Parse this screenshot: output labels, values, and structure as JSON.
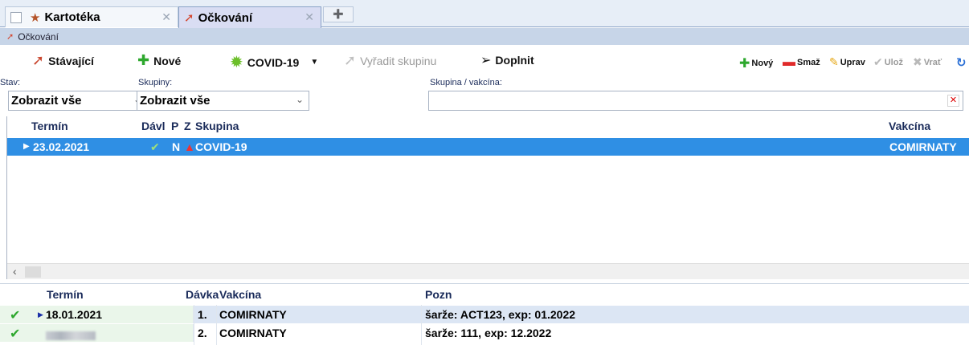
{
  "tabs": [
    {
      "label": "Kartotéka",
      "icon": "people-icon"
    },
    {
      "label": "Očkování",
      "icon": "syringe-icon",
      "active": true
    }
  ],
  "subtitle": "Očkování",
  "toolbar": {
    "existing": "Stávající",
    "new": "Nové",
    "covid": "COVID-19",
    "remove_group": "Vyřadit skupinu",
    "fill": "Doplnit",
    "small_new": "Nový",
    "small_delete": "Smaž",
    "small_edit": "Uprav",
    "small_save": "Ulož",
    "small_revert": "Vrať"
  },
  "filters": {
    "stav_label": "Stav:",
    "stav_value": "Zobrazit vše",
    "skupiny_label": "Skupiny:",
    "skupiny_value": "Zobrazit vše",
    "search_label": "Skupina / vakcína:",
    "search_value": ""
  },
  "upper_grid": {
    "columns": [
      "Termín",
      "Dávl",
      "P",
      "Z",
      "Skupina",
      "Vakcína"
    ],
    "rows": [
      {
        "termin": "23.02.2021",
        "p": "N",
        "skupina": "COVID-19",
        "vakcina": "COMIRNATY"
      }
    ]
  },
  "lower_grid": {
    "columns": [
      "Termín",
      "Dávka",
      "Vakcína",
      "Pozn"
    ],
    "rows": [
      {
        "termin": "18.01.2021",
        "davka": "1.",
        "vakcina": "COMIRNATY",
        "pozn": "šarže: ACT123, exp: 01.2022"
      },
      {
        "termin": "",
        "davka": "2.",
        "vakcina": "COMIRNATY",
        "pozn": "šarže: 111, exp: 12.2022"
      }
    ]
  },
  "colors": {
    "selected_row": "#2f8fe4",
    "lower_selected_row": "#dce6f4",
    "header_text": "#1a2b5a",
    "done_check": "#2ea82e"
  }
}
